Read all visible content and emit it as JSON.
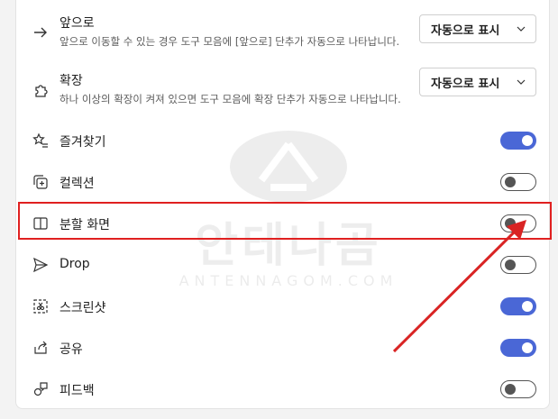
{
  "settings": [
    {
      "id": "back",
      "title": "앞으로",
      "desc": "앞으로 이동할 수 있는 경우 도구 모음에 [앞으로] 단추가 자동으로 나타납니다.",
      "control": "dropdown",
      "value": "자동으로 표시",
      "icon": "forward-arrow-icon"
    },
    {
      "id": "extensions",
      "title": "확장",
      "desc": "하나 이상의 확장이 켜져 있으면 도구 모음에 확장 단추가 자동으로 나타납니다.",
      "control": "dropdown",
      "value": "자동으로 표시",
      "icon": "puzzle-icon"
    },
    {
      "id": "favorites",
      "title": "즐겨찾기",
      "control": "toggle",
      "on": true,
      "icon": "star-list-icon"
    },
    {
      "id": "collections",
      "title": "컬렉션",
      "control": "toggle",
      "on": false,
      "icon": "collections-icon"
    },
    {
      "id": "split",
      "title": "분할 화면",
      "control": "toggle",
      "on": false,
      "icon": "split-screen-icon"
    },
    {
      "id": "drop",
      "title": "Drop",
      "control": "toggle",
      "on": false,
      "icon": "send-icon"
    },
    {
      "id": "screenshot",
      "title": "스크린샷",
      "control": "toggle",
      "on": true,
      "icon": "screenshot-icon"
    },
    {
      "id": "share",
      "title": "공유",
      "control": "toggle",
      "on": true,
      "icon": "share-icon"
    },
    {
      "id": "feedback",
      "title": "피드백",
      "control": "toggle",
      "on": false,
      "icon": "feedback-icon"
    }
  ],
  "watermark": {
    "main": "안테나곰",
    "sub": "ANTENNAGOM.COM"
  },
  "colors": {
    "toggle_on": "#4a67d6",
    "highlight": "#e02020"
  }
}
